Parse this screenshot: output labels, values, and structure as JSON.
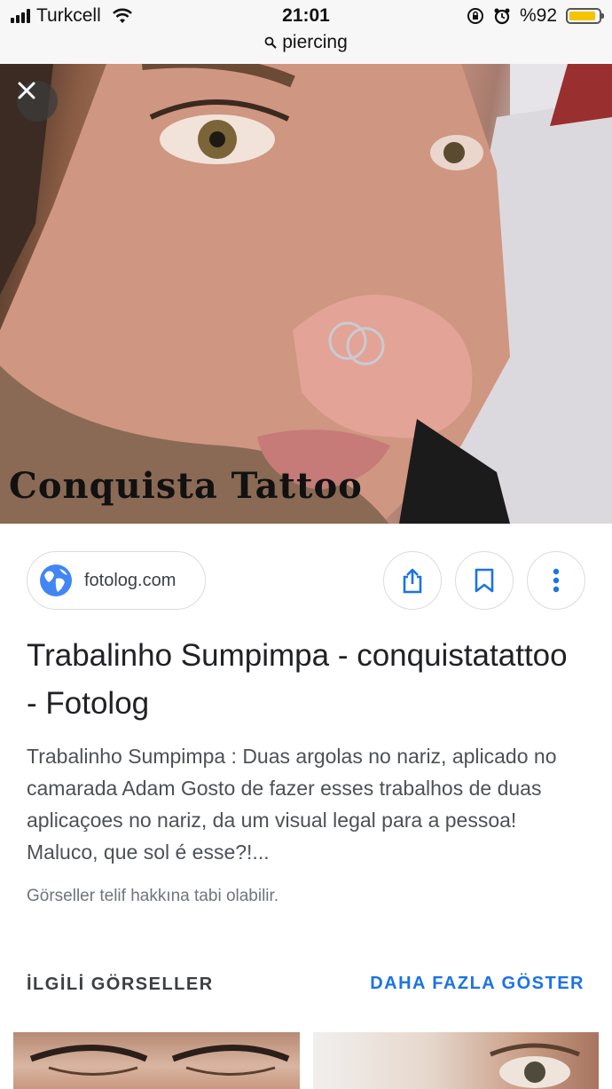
{
  "status_bar": {
    "carrier": "Turkcell",
    "time": "21:01",
    "battery": "%92",
    "battery_level": 0.92,
    "url": "piercing"
  },
  "hero": {
    "watermark": "Conquista Tattoo",
    "close_icon": "close-icon"
  },
  "source": {
    "domain": "fotolog.com",
    "icon": "globe-icon"
  },
  "actions": {
    "share_icon": "share-icon",
    "bookmark_icon": "bookmark-icon",
    "more_icon": "more-vert-icon"
  },
  "result": {
    "title": "Trabalinho Sumpimpa - conquistatattoo - Fotolog",
    "snippet": "Trabalinho Sumpimpa : Duas argolas no nariz, aplicado no camarada Adam Gosto de fazer esses trabalhos de duas aplicaçoes no nariz, da um visual legal para a pessoa! Maluco, que sol é esse?!...",
    "copyright": "Görseller telif hakkına tabi olabilir."
  },
  "related": {
    "heading": "İLGİLİ GÖRSELLER",
    "more_label": "DAHA FAZLA GÖSTER"
  },
  "colors": {
    "accent": "#1a73e8",
    "globe": "#4285f4",
    "battery": "#f5c400"
  }
}
